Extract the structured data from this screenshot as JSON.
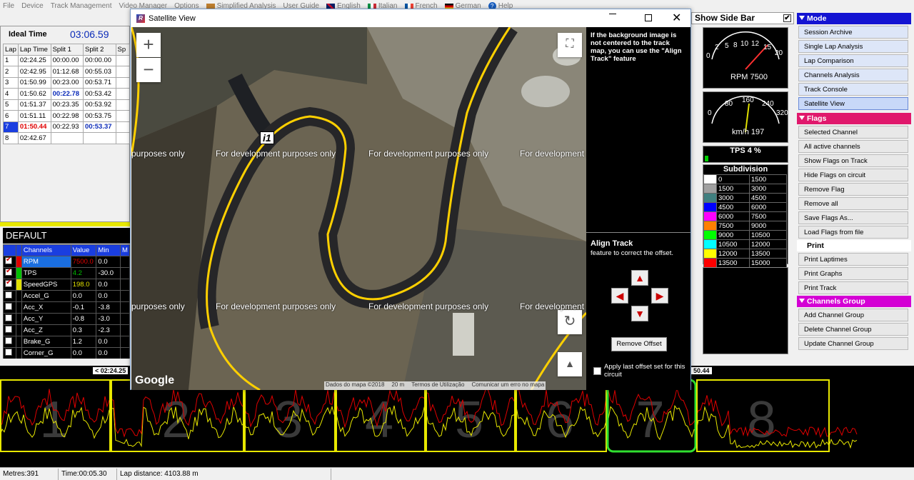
{
  "menubar": {
    "items": [
      "File",
      "Device",
      "Track Management",
      "Video Manager",
      "Options"
    ],
    "simplified": "Simplified Analysis",
    "guide": "User Guide",
    "languages": [
      "English",
      "Italian",
      "French",
      "German"
    ],
    "help": "Help"
  },
  "laps": {
    "ideal_label": "Ideal Time",
    "ideal_value": "03:06.59",
    "headers": [
      "Lap",
      "Lap Time",
      "Split 1",
      "Split 2",
      "Sp"
    ],
    "rows": [
      [
        "1",
        "02:24.25",
        "00:00.00",
        "00:00.00"
      ],
      [
        "2",
        "02:42.95",
        "01:12.68",
        "00:55.03"
      ],
      [
        "3",
        "01:50.99",
        "00:23.00",
        "00:53.71"
      ],
      [
        "4",
        "01:50.62",
        "00:22.78",
        "00:53.42"
      ],
      [
        "5",
        "01:51.37",
        "00:23.35",
        "00:53.92"
      ],
      [
        "6",
        "01:51.11",
        "00:22.98",
        "00:53.75"
      ],
      [
        "7",
        "01:50.44",
        "00:22.93",
        "00:53.37"
      ],
      [
        "8",
        "02:42.67",
        "",
        ""
      ]
    ]
  },
  "channels": {
    "title": "DEFAULT",
    "headers": [
      "Channels",
      "Value",
      "Min",
      "M"
    ],
    "rows": [
      {
        "name": "RPM",
        "value": "7500.0",
        "min": "0.0",
        "checked": true,
        "color": "#e00000"
      },
      {
        "name": "TPS",
        "value": "4.2",
        "min": "-30.0",
        "checked": true,
        "color": "#00c000"
      },
      {
        "name": "SpeedGPS",
        "value": "198.0",
        "min": "0.0",
        "checked": true,
        "color": "#e0e000"
      },
      {
        "name": "Accel_G",
        "value": "0.0",
        "min": "0.0",
        "checked": false,
        "color": "#000000"
      },
      {
        "name": "Acc_X",
        "value": "-0.1",
        "min": "-3.8",
        "checked": false,
        "color": "#000000"
      },
      {
        "name": "Acc_Y",
        "value": "-0.8",
        "min": "-3.0",
        "checked": false,
        "color": "#000000"
      },
      {
        "name": "Acc_Z",
        "value": "0.3",
        "min": "-2.3",
        "checked": false,
        "color": "#000000"
      },
      {
        "name": "Brake_G",
        "value": "1.2",
        "min": "0.0",
        "checked": false,
        "color": "#000000"
      },
      {
        "name": "Corner_G",
        "value": "0.0",
        "min": "0.0",
        "checked": false,
        "color": "#000000"
      }
    ]
  },
  "satellite": {
    "title": "Satellite View",
    "watermark": "For development purposes only",
    "watermark_partial": "purposes only",
    "watermark_partial2": "For development p",
    "marker": "i1",
    "google": "Google",
    "attribution": "Dados do mapa ©2018",
    "scale": "20 m",
    "terms": "Termos de Utilização",
    "report": "Comunicar um erro no mapa",
    "info": "If the background image is not centered to the track map, you can use the \"Align Track\" feature",
    "align_title": "Align Track",
    "align_sub": "feature to correct the offset.",
    "remove_offset": "Remove Offset",
    "apply_last": "Apply last offset set for this circuit"
  },
  "sidebar_toggle": "Show Side Bar",
  "gauges": {
    "rpm_ticks": [
      "0",
      "2",
      "5",
      "8",
      "10",
      "12",
      "15",
      "20"
    ],
    "rpm_label": "RPM 7500",
    "speed_ticks": [
      "0",
      "80",
      "160",
      "240",
      "320"
    ],
    "speed_label": "km/h 197",
    "tps_label": "TPS 4 %",
    "tps_value": 4,
    "subdivision_title": "Subdivision",
    "subdivisions": [
      {
        "from": "0",
        "to": "1500",
        "color": "#ffffff"
      },
      {
        "from": "1500",
        "to": "3000",
        "color": "#a0a0a0"
      },
      {
        "from": "3000",
        "to": "4500",
        "color": "#408080"
      },
      {
        "from": "4500",
        "to": "6000",
        "color": "#0000ff"
      },
      {
        "from": "6000",
        "to": "7500",
        "color": "#ff00ff"
      },
      {
        "from": "7500",
        "to": "9000",
        "color": "#ff8000"
      },
      {
        "from": "9000",
        "to": "10500",
        "color": "#00ff00"
      },
      {
        "from": "10500",
        "to": "12000",
        "color": "#00ffff"
      },
      {
        "from": "12000",
        "to": "13500",
        "color": "#ffff00"
      },
      {
        "from": "13500",
        "to": "15000",
        "color": "#ff0000"
      }
    ]
  },
  "right_menu": {
    "mode": {
      "title": "Mode",
      "color": "#1414d2",
      "items": [
        "Session Archive",
        "Single Lap Analysis",
        "Lap Comparison",
        "Channels Analysis",
        "Track Console",
        "Satellite View"
      ]
    },
    "flags": {
      "title": "Flags",
      "color": "#e0186c",
      "items": [
        "Selected Channel",
        "All active channels",
        "Show Flags on Track",
        "Hide Flags on circuit",
        "Remove Flag",
        "Remove all",
        "Save Flags As...",
        "Load Flags from file"
      ]
    },
    "print": {
      "title": "Print",
      "color": "#000000",
      "items": [
        "Print Laptimes",
        "Print Graphs",
        "Print Track"
      ]
    },
    "groups": {
      "title": "Channels Group",
      "color": "#d400d4",
      "items": [
        "Add Channel Group",
        "Delete Channel Group",
        "Update Channel Group"
      ]
    }
  },
  "graph": {
    "lap_numbers": [
      "1",
      "2",
      "3",
      "4",
      "5",
      "6",
      "7",
      "8"
    ],
    "left_marker": "< 02:24.25",
    "right_marker": "50.44"
  },
  "status": {
    "metres": "Metres:391",
    "time": "Time:00:05.30",
    "lap_distance": "Lap distance: 4103.88 m"
  }
}
